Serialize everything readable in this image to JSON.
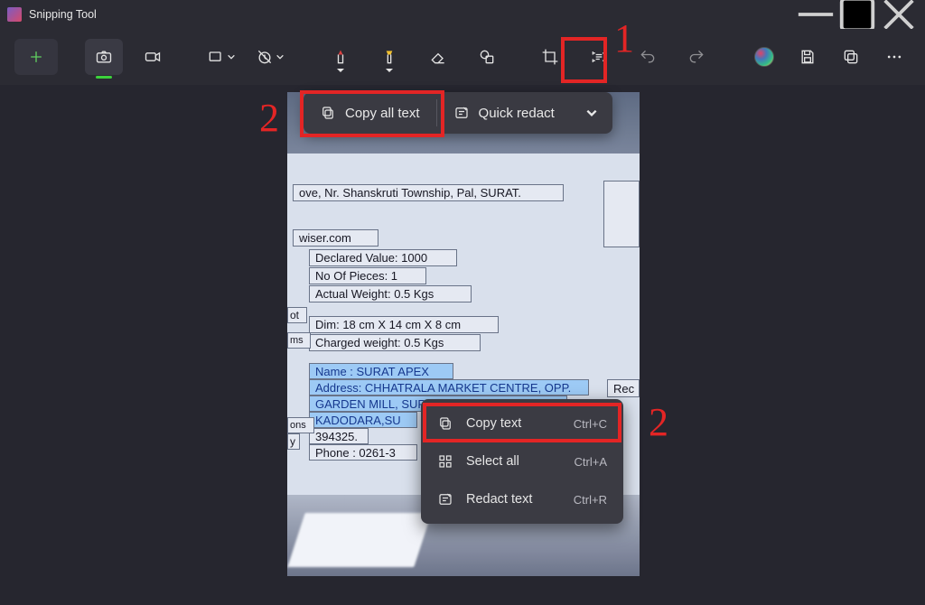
{
  "window": {
    "title": "Snipping Tool"
  },
  "actionbar": {
    "copy_all_label": "Copy all text",
    "quick_redact_label": "Quick redact"
  },
  "context_menu": {
    "copy_text_label": "Copy text",
    "copy_text_shortcut": "Ctrl+C",
    "select_all_label": "Select all",
    "select_all_shortcut": "Ctrl+A",
    "redact_label": "Redact text",
    "redact_shortcut": "Ctrl+R"
  },
  "annotations": {
    "n1": "1",
    "n2a": "2",
    "n2b": "2"
  },
  "receipt": {
    "line_top": "ove, Nr. Shanskruti Township, Pal, SURAT.",
    "site": "wiser.com",
    "declared": "Declared Value: 1000",
    "pieces": "No Of Pieces: 1",
    "actual_wt": "Actual Weight: 0.5 Kgs",
    "dim": "Dim: 18 cm X 14 cm X 8 cm",
    "charged_wt": "Charged weight: 0.5 Kgs",
    "name": "Name : SURAT APEX",
    "addr1": "Address: CHHATRALA MARKET CENTRE, OPP.",
    "addr2": "GARDEN MILL, SURAT KADODARA ROAD,",
    "addr3": "KADODARA,SU",
    "zip": "394325.",
    "phone": "Phone : 0261-3",
    "side_ot": "ot",
    "side_ms": "ms",
    "side_ons": "ons",
    "side_y": "y",
    "right_rec": "Rec",
    "right_col": ""
  }
}
